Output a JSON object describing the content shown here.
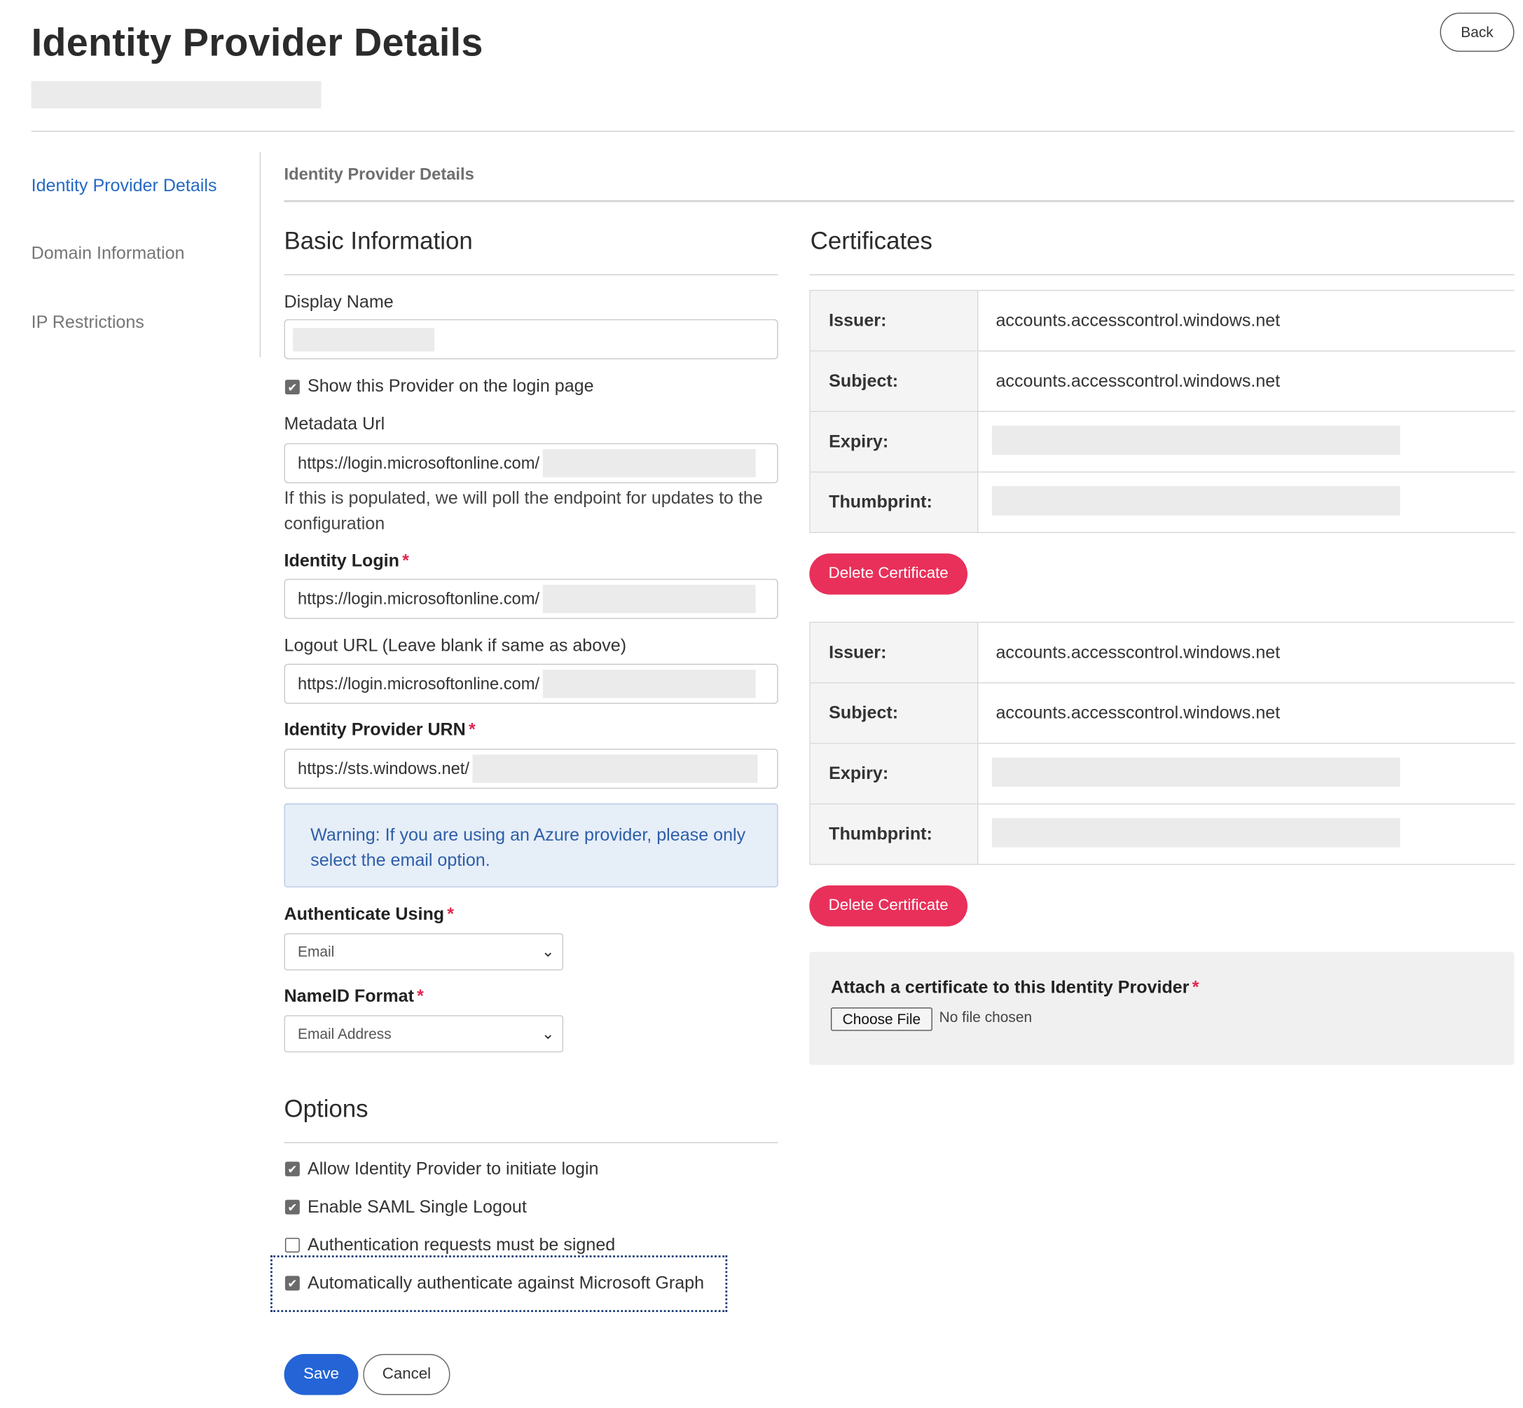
{
  "page": {
    "title": "Identity Provider Details",
    "back_label": "Back"
  },
  "sidebar": {
    "items": [
      {
        "label": "Identity Provider Details",
        "active": true
      },
      {
        "label": "Domain Information",
        "active": false
      },
      {
        "label": "IP Restrictions",
        "active": false
      }
    ]
  },
  "breadcrumb": "Identity Provider Details",
  "basic": {
    "title": "Basic Information",
    "display_name": {
      "label": "Display Name"
    },
    "show_provider": {
      "label": "Show this Provider on the login page",
      "checked": true
    },
    "metadata_url": {
      "label": "Metadata Url",
      "value": "https://login.microsoftonline.com/",
      "help": "If this is populated, we will poll the endpoint for updates to the configuration"
    },
    "identity_login": {
      "label": "Identity Login",
      "value": "https://login.microsoftonline.com/"
    },
    "logout_url": {
      "label": "Logout URL (Leave blank if same as above)",
      "value": "https://login.microsoftonline.com/"
    },
    "idp_urn": {
      "label": "Identity Provider URN",
      "value": "https://sts.windows.net/"
    },
    "warning": "Warning: If you are using an Azure provider, please only select the email option.",
    "authenticate_using": {
      "label": "Authenticate Using",
      "selected": "Email"
    },
    "nameid_format": {
      "label": "NameID Format",
      "selected": "Email Address"
    }
  },
  "options": {
    "title": "Options",
    "items": [
      {
        "label": "Allow Identity Provider to initiate login",
        "checked": true
      },
      {
        "label": "Enable SAML Single Logout",
        "checked": true
      },
      {
        "label": "Authentication requests must be signed",
        "checked": false
      },
      {
        "label": "Automatically authenticate against Microsoft Graph",
        "checked": true
      }
    ]
  },
  "actions": {
    "save": "Save",
    "cancel": "Cancel"
  },
  "certificates": {
    "title": "Certificates",
    "field_labels": {
      "issuer": "Issuer:",
      "subject": "Subject:",
      "expiry": "Expiry:",
      "thumbprint": "Thumbprint:"
    },
    "items": [
      {
        "issuer": "accounts.accesscontrol.windows.net",
        "subject": "accounts.accesscontrol.windows.net"
      },
      {
        "issuer": "accounts.accesscontrol.windows.net",
        "subject": "accounts.accesscontrol.windows.net"
      }
    ],
    "delete_label": "Delete Certificate",
    "attach": {
      "title": "Attach a certificate to this Identity Provider",
      "choose_label": "Choose File",
      "no_file": "No file chosen"
    }
  },
  "icons": {
    "checkmark": "check-icon",
    "chevron": "chevron-down-icon"
  },
  "colors": {
    "accent": "#2464d6",
    "danger": "#e8305a",
    "link": "#2469c5",
    "warning_bg": "#e6eef8"
  }
}
